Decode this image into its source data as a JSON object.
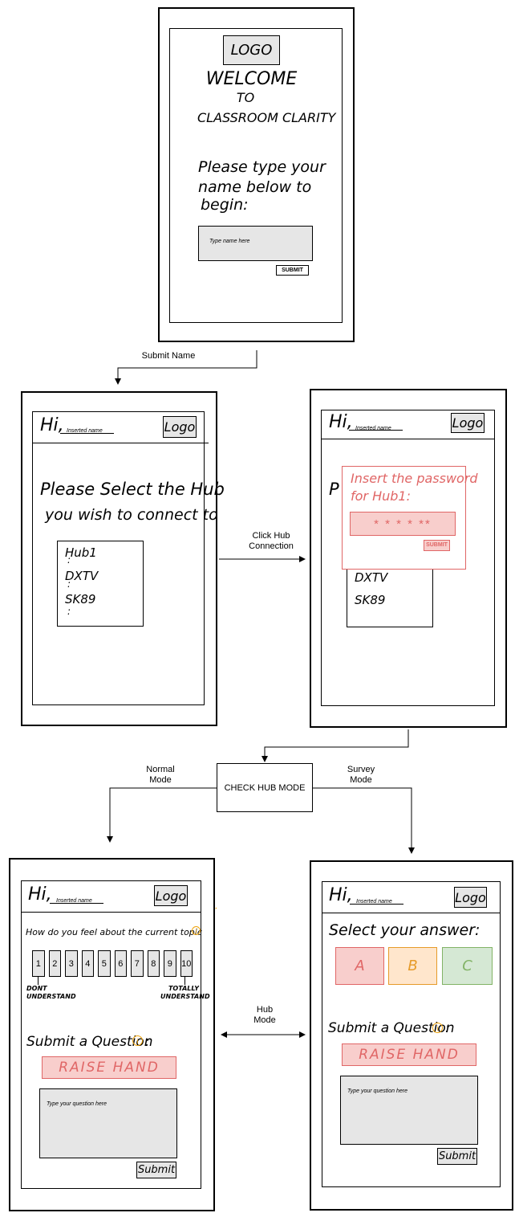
{
  "connectors": {
    "submit_name": "Submit Name",
    "click_hub_line1": "Click Hub",
    "click_hub_line2": "Connection",
    "check_hub_mode": "CHECK HUB MODE",
    "normal_line1": "Normal",
    "normal_line2": "Mode",
    "survey_line1": "Survey",
    "survey_line2": "Mode",
    "hub_line1": "Hub",
    "hub_line2": "Mode"
  },
  "welcome": {
    "logo": "LOGO",
    "line1": "WELCOME",
    "line2": "TO",
    "line3": "CLASSROOM CLARITY",
    "prompt1": "Please type your",
    "prompt2": "name below to",
    "prompt3": "begin:",
    "name_placeholder": "Type name here",
    "submit": "SUBMIT"
  },
  "hub_select": {
    "greeting": "Hi,",
    "name_placeholder": "Inserted name",
    "logo": "Logo",
    "prompt1": "Please Select the Hub",
    "prompt2": "you wish to connect to",
    "hubs": [
      "Hub1",
      "DXTV",
      "SK89"
    ],
    "dots": ":"
  },
  "password": {
    "greeting": "Hi,",
    "name_placeholder": "Inserted name",
    "logo": "Logo",
    "modal_line1": "Insert the password",
    "modal_line2": "for Hub1:",
    "masked": "* * * * **",
    "submit": "SUBMIT",
    "bg_letter": "P",
    "bg_hubs": [
      "DXTV",
      "SK89"
    ]
  },
  "normal_mode": {
    "greeting": "Hi,",
    "name_placeholder": "Inserted name",
    "logo": "Logo",
    "question": "How do you feel about the current topic",
    "scale": [
      "1",
      "2",
      "3",
      "4",
      "5",
      "6",
      "7",
      "8",
      "9",
      "10"
    ],
    "low_label1": "DONT",
    "low_label2": "UNDERSTAND",
    "high_label1": "TOTALLY",
    "high_label2": "UNDERSTAND",
    "submit_question": "Submit a Question",
    "raise_hand": "RAISE HAND",
    "question_placeholder": "Type your question here",
    "submit": "Submit",
    "info_icon": "i"
  },
  "survey_mode": {
    "greeting": "Hi,",
    "name_placeholder": "Inserted name",
    "logo": "Logo",
    "prompt": "Select your answer:",
    "options": [
      "A",
      "B",
      "C"
    ],
    "submit_question": "Submit a Question",
    "raise_hand": "RAISE HAND",
    "question_placeholder": "Type your question here",
    "submit": "Submit",
    "info_icon": "i"
  },
  "colors": {
    "red": "#e06666",
    "red_fill": "#f8cecc",
    "orange": "#e69b2a",
    "orange_fill": "#ffe6cc",
    "green": "#82b366",
    "green_fill": "#d5e8d4",
    "grey": "#e6e6e6",
    "info": "#f0a30a"
  }
}
